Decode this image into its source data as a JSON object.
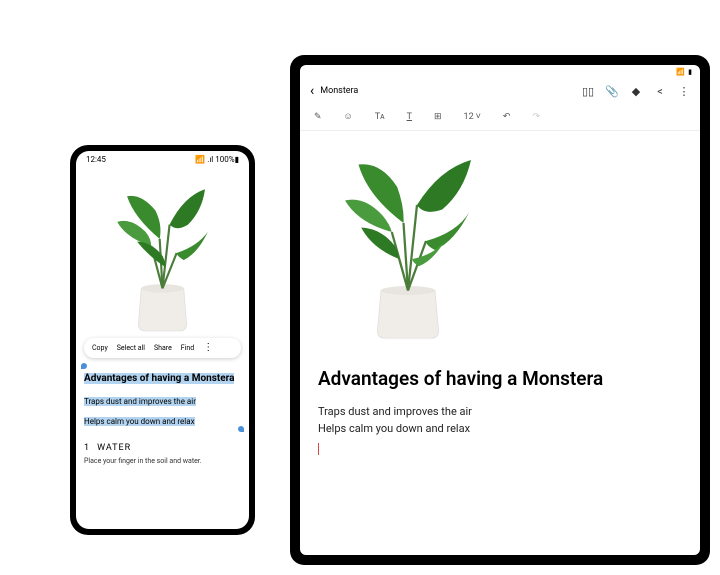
{
  "phone": {
    "status": {
      "time": "12:45",
      "signal": "📶",
      "battery": "100%"
    },
    "context_menu": {
      "copy": "Copy",
      "select_all": "Select all",
      "share": "Share",
      "find": "Find"
    },
    "selected": {
      "title": "Advantages of having a Monstera",
      "line1": "Traps dust and improves the air",
      "line2": "Helps calm you down and relax"
    },
    "section": {
      "number": "1",
      "title": "WATER",
      "body": "Place your finger in the soil and water."
    }
  },
  "tablet": {
    "header": {
      "back": "‹",
      "title": "Monstera"
    },
    "toolbar": {
      "font_size": "12"
    },
    "content": {
      "title": "Advantages of having a Monstera",
      "line1": "Traps dust and improves the air",
      "line2": "Helps calm you down and relax"
    }
  }
}
